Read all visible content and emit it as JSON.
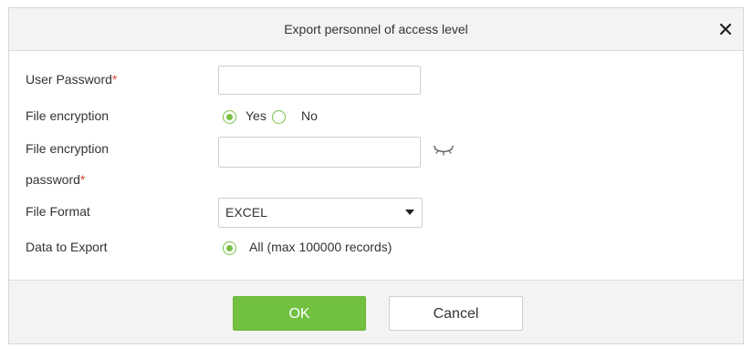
{
  "dialog": {
    "title": "Export personnel of access level",
    "close_icon": "close-icon"
  },
  "form": {
    "user_password": {
      "label": "User Password",
      "required_mark": "*",
      "value": ""
    },
    "file_encryption": {
      "label": "File encryption",
      "options": [
        {
          "label": "Yes",
          "selected": true
        },
        {
          "label": "No",
          "selected": false
        }
      ]
    },
    "encryption_password": {
      "label_line1": "File encryption",
      "label_line2": "password",
      "required_mark": "*",
      "value": "",
      "toggle_icon": "eye-closed-icon"
    },
    "file_format": {
      "label": "File Format",
      "selected": "EXCEL",
      "icon": "chevron-down-icon"
    },
    "data_to_export": {
      "label": "Data to Export",
      "option": "All (max 100000 records)",
      "selected": true
    }
  },
  "buttons": {
    "ok": "OK",
    "cancel": "Cancel"
  },
  "colors": {
    "accent": "#72c040",
    "required": "#e0443a",
    "header_bg": "#f3f3f3"
  }
}
